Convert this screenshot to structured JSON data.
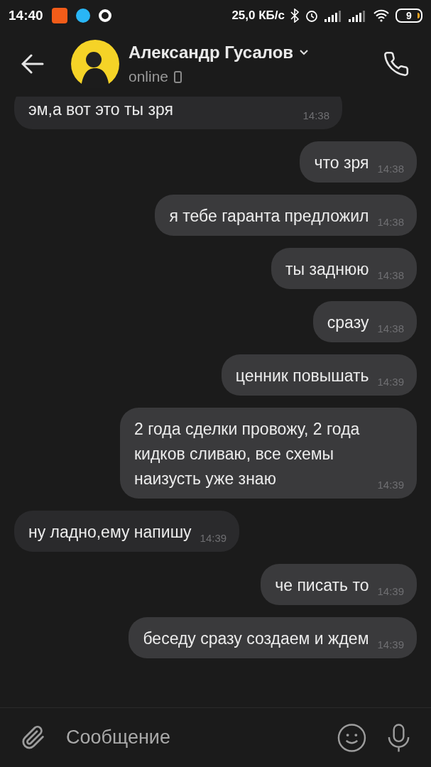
{
  "status_bar": {
    "time": "14:40",
    "speed": "25,0 КБ/с",
    "battery": "9"
  },
  "header": {
    "name": "Александр Гусалов",
    "status": "online"
  },
  "messages": [
    {
      "text": "эм,а вот это ты зря",
      "time": "14:38",
      "outgoing": false
    },
    {
      "text": "что зря",
      "time": "14:38",
      "outgoing": true
    },
    {
      "text": "я тебе гаранта предложил",
      "time": "14:38",
      "outgoing": true
    },
    {
      "text": "ты заднюю",
      "time": "14:38",
      "outgoing": true
    },
    {
      "text": "сразу",
      "time": "14:38",
      "outgoing": true
    },
    {
      "text": "ценник повышать",
      "time": "14:39",
      "outgoing": true
    },
    {
      "text": "2 года сделки провожу, 2 года кидков сливаю, все схемы наизусть уже знаю",
      "time": "14:39",
      "outgoing": true
    },
    {
      "text": "ну ладно,ему напишу",
      "time": "14:39",
      "outgoing": false
    },
    {
      "text": "че писать то",
      "time": "14:39",
      "outgoing": true
    },
    {
      "text": "беседу сразу создаем и ждем",
      "time": "14:39",
      "outgoing": true
    }
  ],
  "composer": {
    "placeholder": "Сообщение"
  }
}
